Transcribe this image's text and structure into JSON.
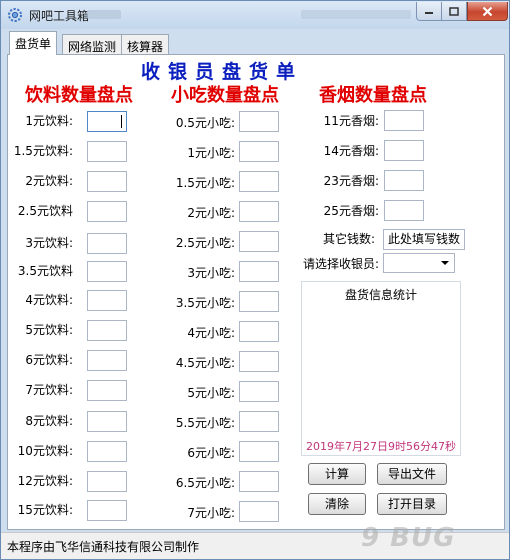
{
  "window": {
    "title": "网吧工具箱"
  },
  "tabs": [
    {
      "label": "盘货单"
    },
    {
      "label": "网络监测"
    },
    {
      "label": "核算器"
    }
  ],
  "main_title": "收银员盘货单",
  "drinks": {
    "title": "饮料数量盘点",
    "items": [
      "1元饮料:",
      "1.5元饮料:",
      "2元饮料:",
      "2.5元饮料",
      "3元饮料:",
      "3.5元饮料",
      "4元饮料:",
      "5元饮料:",
      "6元饮料:",
      "7元饮料:",
      "8元饮料:",
      "10元饮料:",
      "12元饮料:",
      "15元饮料:"
    ]
  },
  "snacks": {
    "title": "小吃数量盘点",
    "items": [
      "0.5元小吃:",
      "1元小吃:",
      "1.5元小吃:",
      "2元小吃:",
      "2.5元小吃:",
      "3元小吃:",
      "3.5元小吃:",
      "4元小吃:",
      "4.5元小吃:",
      "5元小吃:",
      "5.5元小吃:",
      "6元小吃:",
      "6.5元小吃:",
      "7元小吃:"
    ]
  },
  "cigarettes": {
    "title": "香烟数量盘点",
    "items": [
      "11元香烟:",
      "14元香烟:",
      "23元香烟:",
      "25元香烟:"
    ]
  },
  "other_money": {
    "label": "其它钱数:",
    "value": "此处填写钱数"
  },
  "cashier_select": {
    "label": "请选择收银员:",
    "value": ""
  },
  "stats": {
    "title": "盘货信息统计",
    "timestamp": "2019年7月27日9时56分47秒"
  },
  "buttons": {
    "calc": "计算",
    "export": "导出文件",
    "clear": "清除",
    "open_dir": "打开目录"
  },
  "status": {
    "text": "本程序由飞华信通科技有限公司制作"
  },
  "watermark": "9 BUG"
}
